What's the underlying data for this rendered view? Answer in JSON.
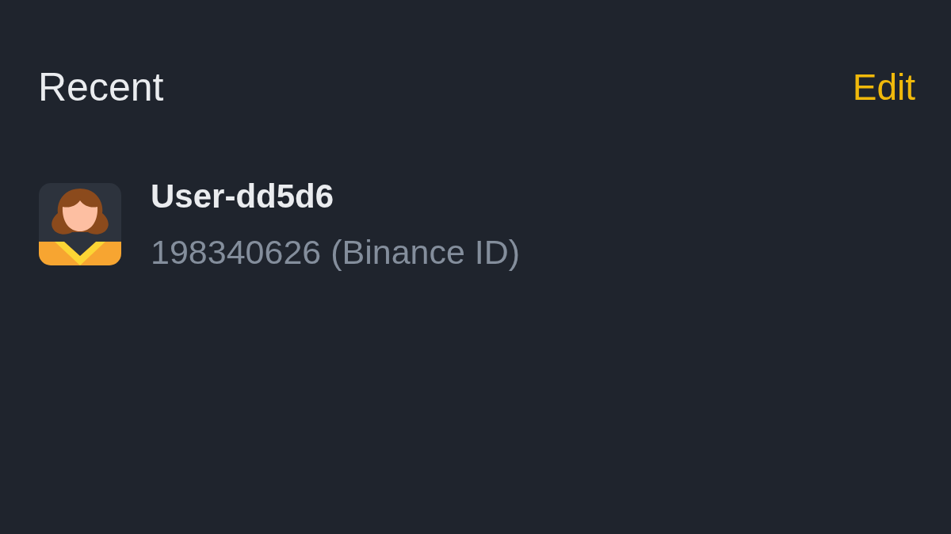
{
  "section": {
    "title": "Recent",
    "action": "Edit"
  },
  "contacts": [
    {
      "name": "User-dd5d6",
      "id_text": "198340626 (Binance ID)"
    }
  ]
}
